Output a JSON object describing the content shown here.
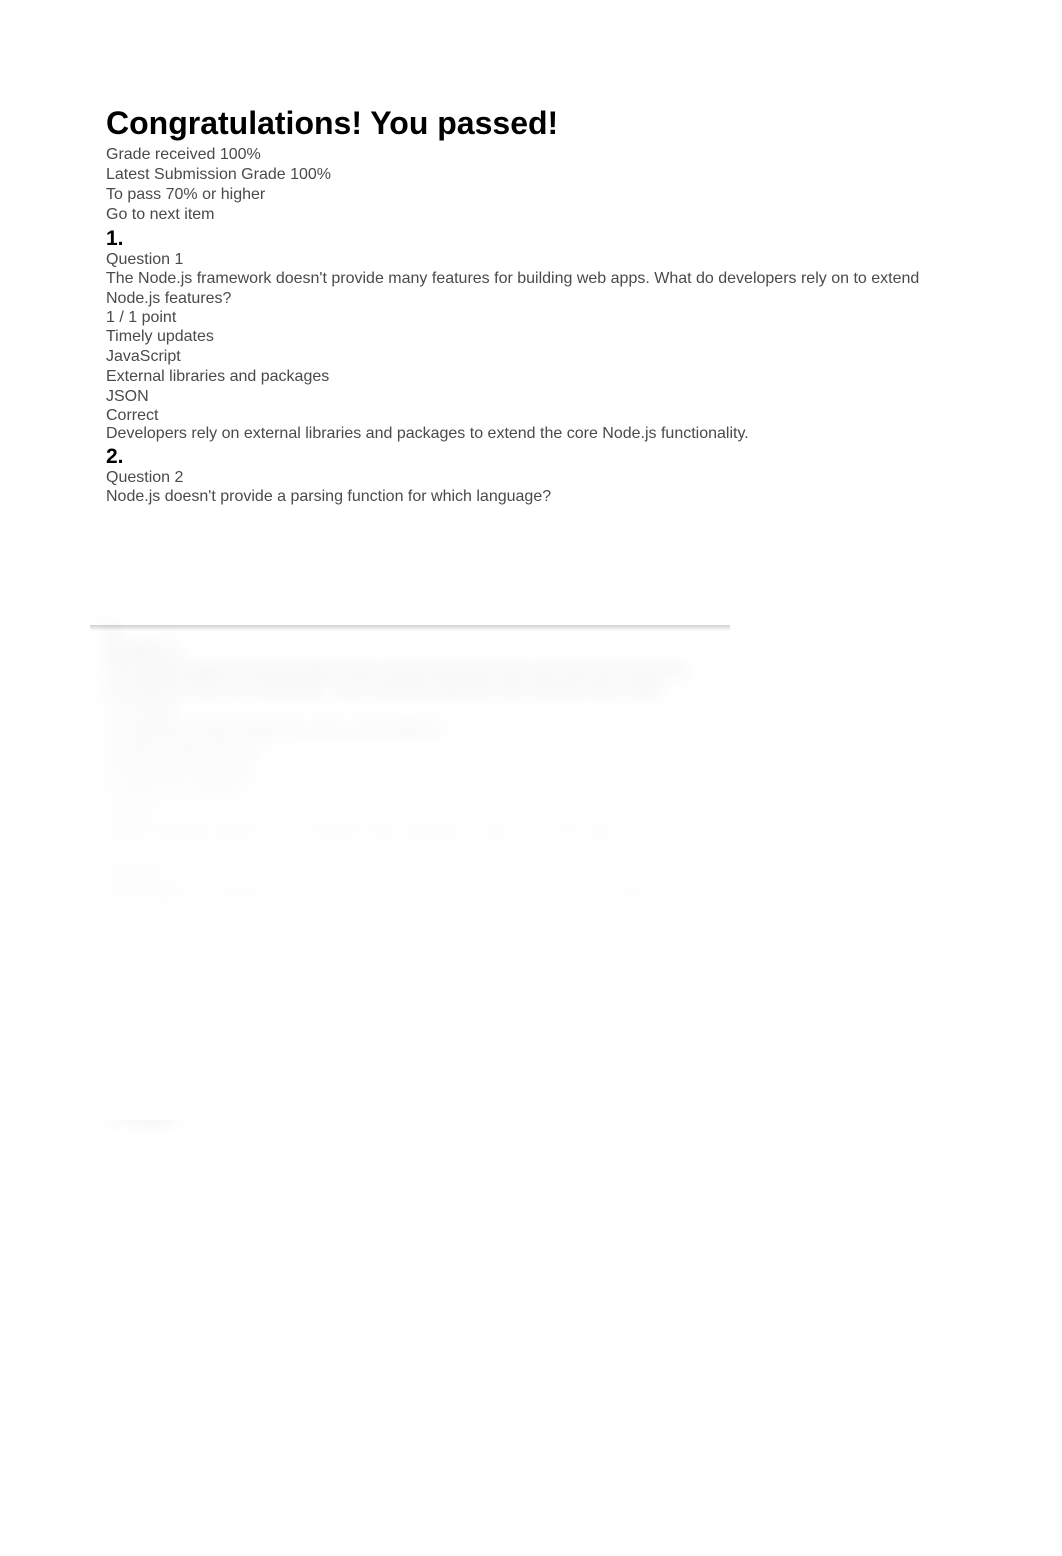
{
  "header": {
    "title": "Congratulations! You passed!",
    "grade_label": "Grade received",
    "grade_value": "100%",
    "latest_label": "Latest Submission Grade",
    "latest_value": "100%",
    "topass_label": "To pass",
    "topass_value": "70% or higher",
    "next_link": "Go to next item"
  },
  "questions": [
    {
      "num": "1.",
      "label": "Question 1",
      "text": "The Node.js framework doesn't provide many features for building web apps. What do developers rely on to extend Node.js features?",
      "points": "1 / 1 point",
      "options": [
        "Timely updates",
        "JavaScript",
        "External libraries and packages",
        "JSON"
      ],
      "correct": "Correct",
      "feedback": "Developers rely on external libraries and packages to extend the core Node.js functionality."
    },
    {
      "num": "2.",
      "label": "Question 2",
      "text": "Node.js doesn't provide a parsing function for which language?",
      "points": "",
      "options": [],
      "correct": "",
      "feedback": ""
    }
  ],
  "blurred": {
    "q3_num": "3.",
    "q3_label": "Question 3",
    "q3_line1": "The disadvantage of representation state using matching arrays are XML-like structures",
    "q3_line2": "describing a XML into JavaScript. They matching might be more efficient than might",
    "q3_points": "1 / 1 point",
    "q3_opt1": "To represent string matching it not to more efficient",
    "q3_opt2": "To state writing function",
    "q3_opt3": "To state the XML tags",
    "q3_opt4": "To XML into element",
    "q3_correct": "Correct",
    "q3_feedback": "String matching might be more efficient than building an XML tree of the style.",
    "q4_num": "4.",
    "q4_label": "Question 4",
    "q4_text": "Which Node.js package converts a string of XML elements into a JavaScript object?",
    "q4_points": "1 / 1 point",
    "q4_opt1": "Async.js",
    "q4_opt2": "xjs",
    "q4_opt3": "Express.js",
    "q4_opt4": "xml2js",
    "q4_correct": "Correct",
    "q4_feedback": "xml2js is a Node.js package parses a string of XML element into a JavaScript object.",
    "q5_num": "5.",
    "q5_label": "Question 5",
    "q5_text": "What web application framework is based on the Node.js runtime environment?",
    "q5_points": "1 / 1 point"
  }
}
